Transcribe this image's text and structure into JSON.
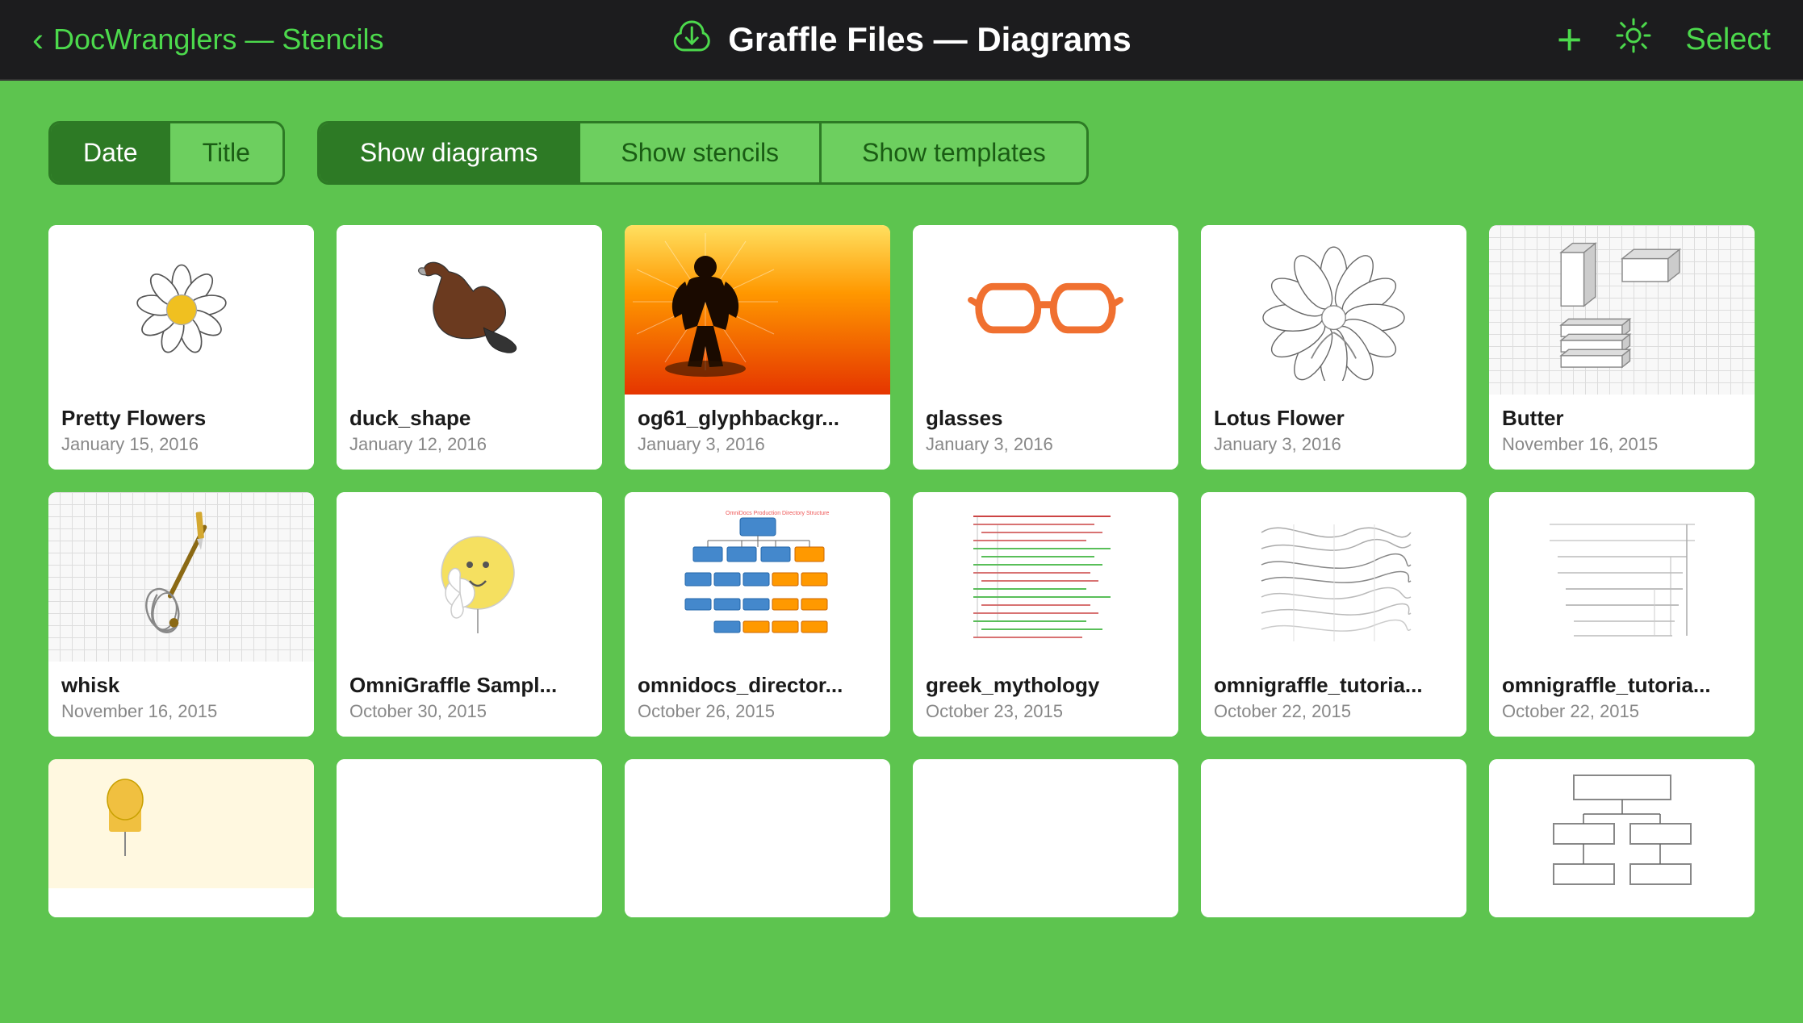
{
  "nav": {
    "back_label": "DocWranglers — Stencils",
    "title": "Graffle Files — Diagrams",
    "plus_icon": "+",
    "gear_icon": "⚙",
    "select_label": "Select"
  },
  "filters": {
    "sort": {
      "date_label": "Date",
      "title_label": "Title",
      "active": "date"
    },
    "view": {
      "diagrams_label": "Show diagrams",
      "stencils_label": "Show stencils",
      "templates_label": "Show templates",
      "active": "diagrams"
    }
  },
  "files": [
    {
      "name": "Pretty Flowers",
      "date": "January 15, 2016",
      "thumb": "flowers"
    },
    {
      "name": "duck_shape",
      "date": "January 12, 2016",
      "thumb": "duck"
    },
    {
      "name": "og61_glyphbackgr...",
      "date": "January 3, 2016",
      "thumb": "glyph"
    },
    {
      "name": "glasses",
      "date": "January 3, 2016",
      "thumb": "glasses"
    },
    {
      "name": "Lotus Flower",
      "date": "January 3, 2016",
      "thumb": "lotus"
    },
    {
      "name": "Butter",
      "date": "November 16, 2015",
      "thumb": "butter"
    },
    {
      "name": "whisk",
      "date": "November 16, 2015",
      "thumb": "whisk"
    },
    {
      "name": "OmniGraffle Sampl...",
      "date": "October 30, 2015",
      "thumb": "omnigraffle"
    },
    {
      "name": "omnidocs_director...",
      "date": "October 26, 2015",
      "thumb": "omnidocs"
    },
    {
      "name": "greek_mythology",
      "date": "October 23, 2015",
      "thumb": "greek"
    },
    {
      "name": "omnigraffle_tutoria...",
      "date": "October 22, 2015",
      "thumb": "tutorial1"
    },
    {
      "name": "omnigraffle_tutoria...",
      "date": "October 22, 2015",
      "thumb": "tutorial2"
    },
    {
      "name": "",
      "date": "",
      "thumb": "partial1"
    },
    {
      "name": "",
      "date": "",
      "thumb": "partial2"
    },
    {
      "name": "",
      "date": "",
      "thumb": "partial3"
    },
    {
      "name": "",
      "date": "",
      "thumb": "partial4"
    },
    {
      "name": "",
      "date": "",
      "thumb": "partial5"
    },
    {
      "name": "",
      "date": "",
      "thumb": "partial6"
    }
  ]
}
